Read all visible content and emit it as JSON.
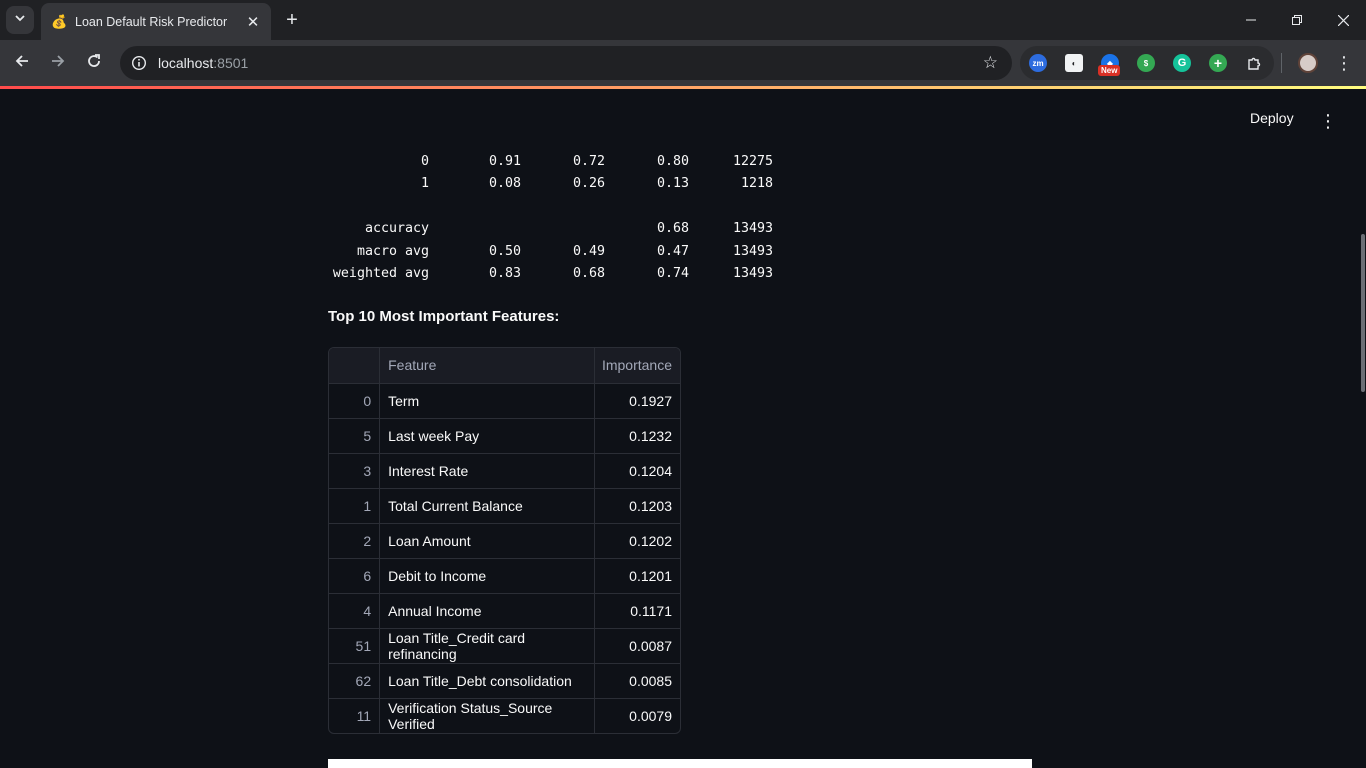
{
  "browser": {
    "tab_title": "Loan Default Risk Predictor",
    "tab_favicon": "💰",
    "url_host": "localhost",
    "url_port": ":8501",
    "extensions": [
      {
        "name": "zoom-extension-icon",
        "label": "zm",
        "color": "#2d6cdf"
      },
      {
        "name": "ink-extension-icon",
        "label": "✎",
        "color": "#3c3c3c"
      },
      {
        "name": "new-badge-extension-icon",
        "label": "●",
        "color": "#1a73e8"
      },
      {
        "name": "money-extension-icon",
        "label": "$",
        "color": "#34a853"
      },
      {
        "name": "grammarly-extension-icon",
        "label": "G",
        "color": "#15c39a"
      },
      {
        "name": "plus-extension-icon",
        "label": "+",
        "color": "#34a853"
      },
      {
        "name": "puzzle-extension-icon",
        "label": "⧉",
        "color": "#35363a"
      }
    ],
    "ext_badge": "New"
  },
  "app": {
    "deploy_label": "Deploy"
  },
  "report": {
    "rows": [
      {
        "label": "0",
        "precision": "0.91",
        "recall": "0.72",
        "f1": "0.80",
        "support": "12275"
      },
      {
        "label": "1",
        "precision": "0.08",
        "recall": "0.26",
        "f1": "0.13",
        "support": "1218"
      },
      {
        "label": "accuracy",
        "precision": "",
        "recall": "",
        "f1": "0.68",
        "support": "13493"
      },
      {
        "label": "macro avg",
        "precision": "0.50",
        "recall": "0.49",
        "f1": "0.47",
        "support": "13493"
      },
      {
        "label": "weighted avg",
        "precision": "0.83",
        "recall": "0.68",
        "f1": "0.74",
        "support": "13493"
      }
    ]
  },
  "features": {
    "heading": "Top 10 Most Important Features:",
    "columns": [
      "",
      "Feature",
      "Importance"
    ],
    "rows": [
      {
        "index": "0",
        "feature": "Term",
        "importance": "0.1927"
      },
      {
        "index": "5",
        "feature": "Last week Pay",
        "importance": "0.1232"
      },
      {
        "index": "3",
        "feature": "Interest Rate",
        "importance": "0.1204"
      },
      {
        "index": "1",
        "feature": "Total Current Balance",
        "importance": "0.1203"
      },
      {
        "index": "2",
        "feature": "Loan Amount",
        "importance": "0.1202"
      },
      {
        "index": "6",
        "feature": "Debit to Income",
        "importance": "0.1201"
      },
      {
        "index": "4",
        "feature": "Annual Income",
        "importance": "0.1171"
      },
      {
        "index": "51",
        "feature": "Loan Title_Credit card refinancing",
        "importance": "0.0087"
      },
      {
        "index": "62",
        "feature": "Loan Title_Debt consolidation",
        "importance": "0.0085"
      },
      {
        "index": "11",
        "feature": "Verification Status_Source Verified",
        "importance": "0.0079"
      }
    ]
  }
}
